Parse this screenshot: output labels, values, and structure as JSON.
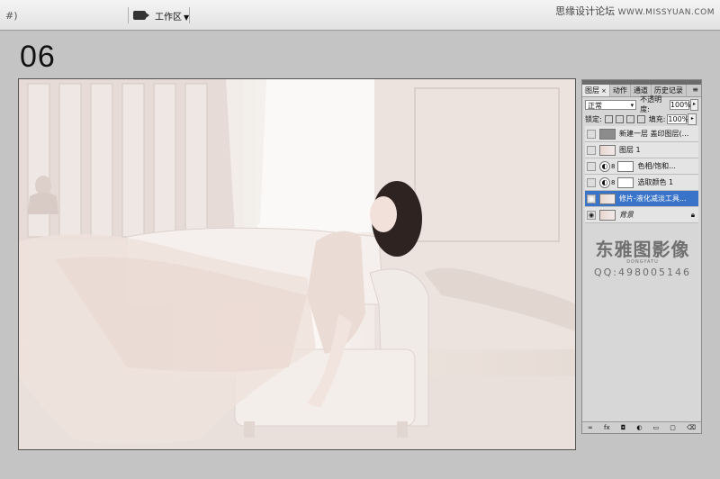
{
  "topbar": {
    "tool_glyph": "#)",
    "workspace_label": "工作区",
    "site_label": "思缘设计论坛",
    "site_url": "WWW.MISSYUAN.COM"
  },
  "step_number": "06",
  "panel": {
    "tabs": [
      {
        "label": "图层",
        "active": true
      },
      {
        "label": "动作"
      },
      {
        "label": "通道"
      },
      {
        "label": "历史记录"
      }
    ],
    "blend_mode": "正常",
    "opacity_label": "不透明度:",
    "opacity_value": "100%",
    "lock_label": "锁定:",
    "fill_label": "填充:",
    "fill_value": "100%",
    "layers": [
      {
        "name": "新建一层 盖印图层(...",
        "thumb": "gray"
      },
      {
        "name": "图层 1",
        "thumb": "photo"
      },
      {
        "name": "色相/饱和...",
        "thumb": "adjustment"
      },
      {
        "name": "选取颜色 1",
        "thumb": "adjustment"
      },
      {
        "name": "修片-液化减淡工具...",
        "thumb": "photo",
        "selected": true
      },
      {
        "name": "背景",
        "thumb": "photo",
        "locked": true
      }
    ],
    "watermark": {
      "title": "东雅图影像",
      "subtitle": "DONGYATU",
      "qq": "QQ:498005146"
    },
    "footer_icons": [
      "link-icon",
      "fx-icon",
      "mask-icon",
      "adjustment-icon",
      "group-icon",
      "new-layer-icon",
      "trash-icon"
    ]
  }
}
